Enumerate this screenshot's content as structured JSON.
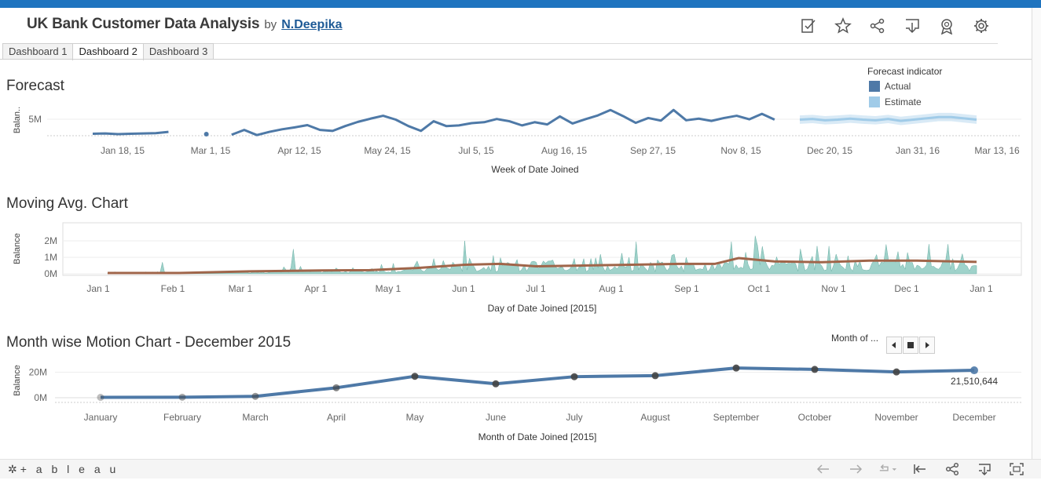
{
  "header": {
    "title": "UK Bank Customer Data Analysis",
    "by": "by",
    "author": "N.Deepika"
  },
  "toolbar_icons": [
    "edit-icon",
    "star-icon",
    "share-icon",
    "download-icon",
    "badge-icon",
    "gear-icon"
  ],
  "tabs": [
    {
      "label": "Dashboard 1",
      "active": false
    },
    {
      "label": "Dashboard 2",
      "active": true
    },
    {
      "label": "Dashboard 3",
      "active": false
    }
  ],
  "colors": {
    "actual": "#4e79a7",
    "estimate": "#a0cbe8",
    "ma_area": "#7fc3b8",
    "ma_line": "#a0654a",
    "motion_line": "#4e79a7",
    "motion_dot": "#444444",
    "topbar": "#1f74bf"
  },
  "chart_data": [
    {
      "type": "line",
      "title": "Forecast",
      "ylabel": "Balan..",
      "xlabel": "Week of Date Joined",
      "yticks": [
        "5M"
      ],
      "ylim": [
        0,
        10000000
      ],
      "xticks": [
        "Jan 18, 15",
        "Mar 1, 15",
        "Apr 12, 15",
        "May 24, 15",
        "Jul 5, 15",
        "Aug 16, 15",
        "Sep 27, 15",
        "Nov 8, 15",
        "Dec 20, 15",
        "Jan 31, 16",
        "Mar 13, 16"
      ],
      "legend": {
        "title": "Forecast indicator",
        "items": [
          "Actual",
          "Estimate"
        ],
        "placement": "top-right"
      },
      "series": [
        {
          "name": "Actual",
          "segments": [
            [
              [
                0,
                0.6
              ],
              [
                1,
                0.7
              ],
              [
                2,
                0.5
              ],
              [
                3,
                0.6
              ],
              [
                4,
                0.7
              ],
              [
                5,
                0.8
              ],
              [
                6,
                1.2
              ]
            ],
            [
              [
                9,
                0.5
              ]
            ],
            [
              [
                11,
                0.3
              ],
              [
                12,
                1.8
              ],
              [
                13,
                0.2
              ],
              [
                14,
                1.2
              ],
              [
                15,
                2.0
              ],
              [
                16,
                2.6
              ],
              [
                17,
                3.3
              ],
              [
                18,
                1.8
              ],
              [
                19,
                1.5
              ],
              [
                20,
                3.0
              ],
              [
                21,
                4.3
              ],
              [
                22,
                5.3
              ],
              [
                23,
                6.2
              ],
              [
                24,
                5.0
              ],
              [
                25,
                3.0
              ],
              [
                26,
                1.5
              ],
              [
                27,
                4.5
              ],
              [
                28,
                3.0
              ],
              [
                29,
                3.2
              ],
              [
                30,
                3.9
              ],
              [
                31,
                4.2
              ],
              [
                32,
                5.2
              ],
              [
                33,
                4.5
              ],
              [
                34,
                3.2
              ],
              [
                35,
                4.2
              ],
              [
                36,
                3.5
              ],
              [
                37,
                6.0
              ],
              [
                38,
                3.8
              ],
              [
                39,
                5.1
              ],
              [
                40,
                6.3
              ],
              [
                41,
                8.0
              ],
              [
                42,
                6.1
              ],
              [
                43,
                4.0
              ],
              [
                44,
                5.5
              ],
              [
                45,
                4.7
              ],
              [
                46,
                8.0
              ],
              [
                47,
                4.8
              ],
              [
                48,
                5.3
              ],
              [
                49,
                4.6
              ],
              [
                50,
                5.5
              ],
              [
                51,
                6.2
              ],
              [
                52,
                5.1
              ],
              [
                53,
                6.8
              ],
              [
                54,
                5.0
              ]
            ]
          ]
        },
        {
          "name": "Estimate",
          "values": [
            [
              56,
              5.0
            ],
            [
              57,
              5.2
            ],
            [
              58,
              4.8
            ],
            [
              59,
              5.0
            ],
            [
              60,
              5.3
            ],
            [
              61,
              5.0
            ],
            [
              62,
              4.8
            ],
            [
              63,
              5.2
            ],
            [
              64,
              4.6
            ],
            [
              65,
              5.0
            ],
            [
              66,
              5.4
            ],
            [
              67,
              5.8
            ],
            [
              68,
              5.8
            ],
            [
              69,
              5.4
            ],
            [
              70,
              5.0
            ]
          ]
        }
      ]
    },
    {
      "type": "area",
      "title": "Moving Avg. Chart",
      "ylabel": "Balance",
      "xlabel": "Day of Date Joined [2015]",
      "yticks": [
        "2M",
        "1M",
        "0M"
      ],
      "ylim": [
        0,
        2400000
      ],
      "xticks": [
        "Jan 1",
        "Feb 1",
        "Mar 1",
        "Apr 1",
        "May 1",
        "Jun 1",
        "Jul 1",
        "Aug 1",
        "Sep 1",
        "Oct 1",
        "Nov 1",
        "Dec 1",
        "Jan 1"
      ],
      "series": [
        {
          "name": "Balance",
          "kind": "area"
        },
        {
          "name": "Moving average",
          "kind": "line",
          "values": [
            [
              0,
              0.05
            ],
            [
              30,
              0.05
            ],
            [
              60,
              0.15
            ],
            [
              90,
              0.2
            ],
            [
              110,
              0.22
            ],
            [
              130,
              0.35
            ],
            [
              150,
              0.55
            ],
            [
              165,
              0.6
            ],
            [
              180,
              0.45
            ],
            [
              200,
              0.5
            ],
            [
              220,
              0.55
            ],
            [
              240,
              0.6
            ],
            [
              255,
              0.6
            ],
            [
              265,
              0.95
            ],
            [
              280,
              0.75
            ],
            [
              300,
              0.7
            ],
            [
              320,
              0.8
            ],
            [
              340,
              0.8
            ],
            [
              365,
              0.72
            ]
          ]
        }
      ]
    },
    {
      "type": "line",
      "title": "Month wise Motion Chart - December 2015",
      "ylabel": "Balance",
      "xlabel": "Month of Date Joined [2015]",
      "yticks": [
        "20M",
        "0M"
      ],
      "ylim": [
        0,
        28000000
      ],
      "categories": [
        "January",
        "February",
        "March",
        "April",
        "May",
        "June",
        "July",
        "August",
        "September",
        "October",
        "November",
        "December"
      ],
      "values": [
        0.3,
        0.4,
        1.1,
        7.8,
        16.8,
        10.9,
        16.5,
        17.3,
        23.3,
        22.2,
        20.2,
        21.51
      ],
      "data_label": "21,510,644"
    }
  ],
  "motion_control": {
    "label": "Month of ..."
  },
  "footer": {
    "logo": "+ a b l e a u"
  }
}
